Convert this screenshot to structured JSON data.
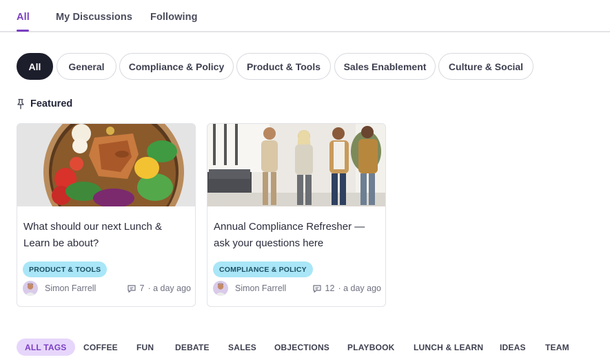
{
  "tabs": [
    {
      "label": "All",
      "active": true
    },
    {
      "label": "My Discussions",
      "active": false
    },
    {
      "label": "Following",
      "active": false
    }
  ],
  "categories": [
    "All",
    "General",
    "Compliance & Policy",
    "Product & Tools",
    "Sales Enablement",
    "Culture & Social"
  ],
  "active_category": "All",
  "featured": {
    "heading": "Featured",
    "icon": "pin-icon"
  },
  "cards": [
    {
      "title": "What should our next Lunch & Learn be about?",
      "tag": "PRODUCT & TOOLS",
      "author": "Simon Farrell",
      "comments": "7",
      "time": "· a day ago",
      "image": "salad-bowl-photo"
    },
    {
      "title": "Annual Compliance Refresher — ask your questions here",
      "tag": "COMPLIANCE & POLICY",
      "author": "Simon Farrell",
      "comments": "12",
      "time": "· a day ago",
      "image": "office-team-photo"
    }
  ],
  "tags": [
    "ALL TAGS",
    "COFFEE",
    "FUN",
    "DEBATE",
    "SALES",
    "OBJECTIONS",
    "PLAYBOOK",
    "LUNCH & LEARN",
    "IDEAS",
    "TEAM"
  ],
  "colors": {
    "accent": "#7b3fc4",
    "tag_pill": "#a9e6f7",
    "active_chip": "#1d1e2c",
    "active_tag_bg": "#e7d6fb"
  }
}
